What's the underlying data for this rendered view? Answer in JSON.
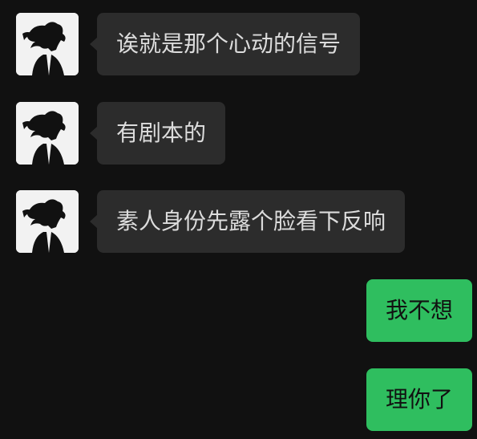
{
  "colors": {
    "background": "#111111",
    "incoming_bubble": "#2c2c2c",
    "outgoing_bubble": "#2fbe5f",
    "incoming_text": "#dcdcdc",
    "outgoing_text": "#111111"
  },
  "messages": [
    {
      "direction": "incoming",
      "avatar": "contact-avatar",
      "text": "诶就是那个心动的信号"
    },
    {
      "direction": "incoming",
      "avatar": "contact-avatar",
      "text": "有剧本的"
    },
    {
      "direction": "incoming",
      "avatar": "contact-avatar",
      "text": "素人身份先露个脸看下反响"
    },
    {
      "direction": "outgoing",
      "text": "我不想"
    },
    {
      "direction": "outgoing",
      "text": "理你了"
    }
  ]
}
